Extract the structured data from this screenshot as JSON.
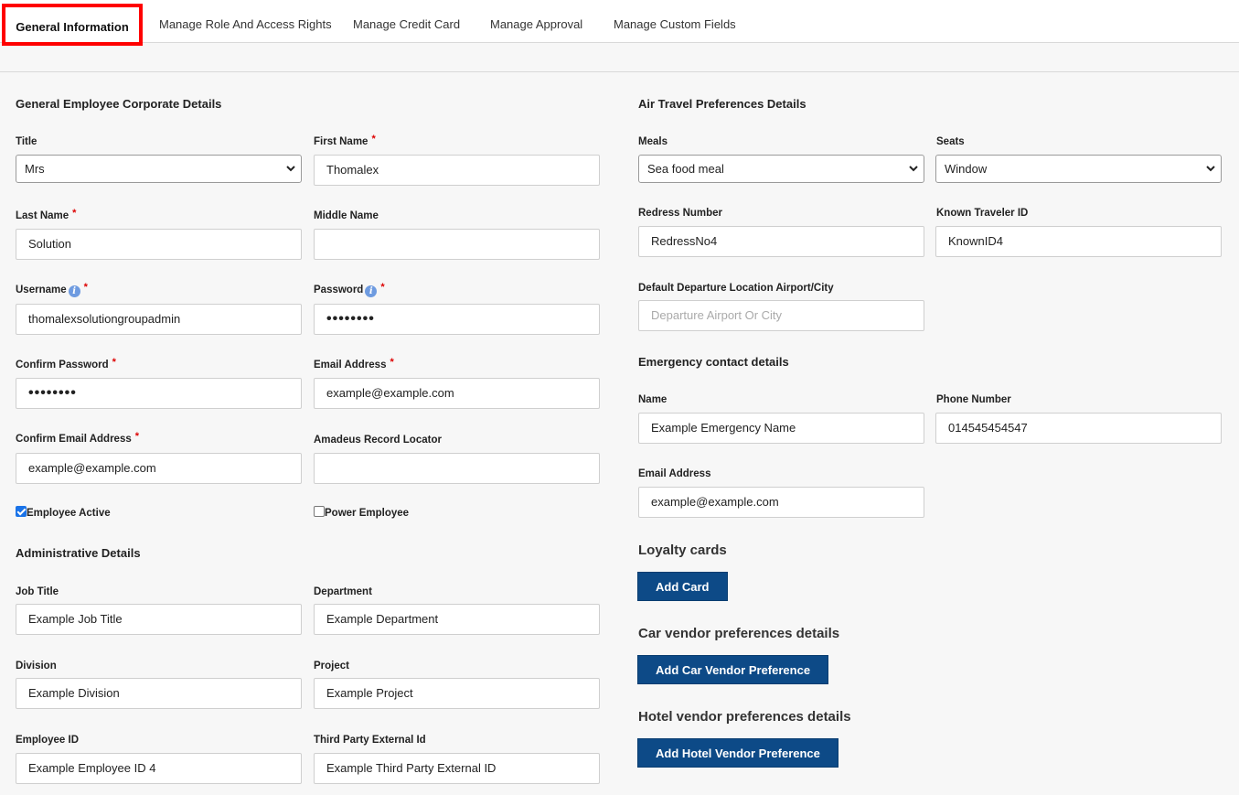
{
  "tabs": [
    {
      "label": "General Information"
    },
    {
      "label": "Manage Role And Access Rights"
    },
    {
      "label": "Manage Credit Card"
    },
    {
      "label": "Manage Approval"
    },
    {
      "label": "Manage Custom Fields"
    }
  ],
  "left": {
    "section_title": "General Employee Corporate Details",
    "title": {
      "label": "Title",
      "value": "Mrs"
    },
    "first_name": {
      "label": "First Name",
      "value": "Thomalex"
    },
    "last_name": {
      "label": "Last Name",
      "value": "Solution"
    },
    "middle_name": {
      "label": "Middle Name",
      "value": ""
    },
    "username": {
      "label": "Username",
      "value": "thomalexsolutiongroupadmin"
    },
    "password": {
      "label": "Password",
      "value": "••••••••"
    },
    "confirm_password": {
      "label": "Confirm Password",
      "value": "••••••••"
    },
    "email": {
      "label": "Email Address",
      "value": "example@example.com"
    },
    "confirm_email": {
      "label": "Confirm Email Address",
      "value": "example@example.com"
    },
    "amadeus": {
      "label": "Amadeus Record Locator",
      "value": ""
    },
    "employee_active": {
      "label": "Employee Active",
      "checked": true
    },
    "power_employee": {
      "label": "Power Employee",
      "checked": false
    },
    "admin_title": "Administrative Details",
    "job_title": {
      "label": "Job Title",
      "value": "Example Job Title"
    },
    "department": {
      "label": "Department",
      "value": "Example Department"
    },
    "division": {
      "label": "Division",
      "value": "Example Division"
    },
    "project": {
      "label": "Project",
      "value": "Example Project"
    },
    "employee_id": {
      "label": "Employee ID",
      "value": "Example Employee ID 4"
    },
    "third_party": {
      "label": "Third Party External Id",
      "value": "Example Third Party External ID"
    },
    "required_mark": "*",
    "info_glyph": "i"
  },
  "right": {
    "section_title": "Air Travel Preferences Details",
    "meals": {
      "label": "Meals",
      "value": "Sea food meal"
    },
    "seats": {
      "label": "Seats",
      "value": "Window"
    },
    "redress": {
      "label": "Redress Number",
      "value": "RedressNo4"
    },
    "known_traveler": {
      "label": "Known Traveler ID",
      "value": "KnownID4"
    },
    "departure": {
      "label": "Default Departure Location Airport/City",
      "placeholder": "Departure Airport Or City"
    },
    "emergency_title": "Emergency contact details",
    "em_name": {
      "label": "Name",
      "value": "Example Emergency Name"
    },
    "em_phone": {
      "label": "Phone Number",
      "value": "014545454547"
    },
    "em_email": {
      "label": "Email Address",
      "value": "example@example.com"
    },
    "loyalty_title": "Loyalty cards",
    "add_card": "Add Card",
    "car_title": "Car vendor preferences details",
    "add_car": "Add Car Vendor Preference",
    "hotel_title": "Hotel vendor preferences details",
    "add_hotel": "Add Hotel Vendor Preference"
  },
  "icons": {
    "info": "info-icon",
    "select_arrow": "chevron-down-icon",
    "checkbox_check": "check-icon"
  },
  "colors": {
    "primary_button": "#0d4a87",
    "highlight_border": "#ff0000",
    "required": "#dd0000",
    "info": "#6e9be0"
  }
}
